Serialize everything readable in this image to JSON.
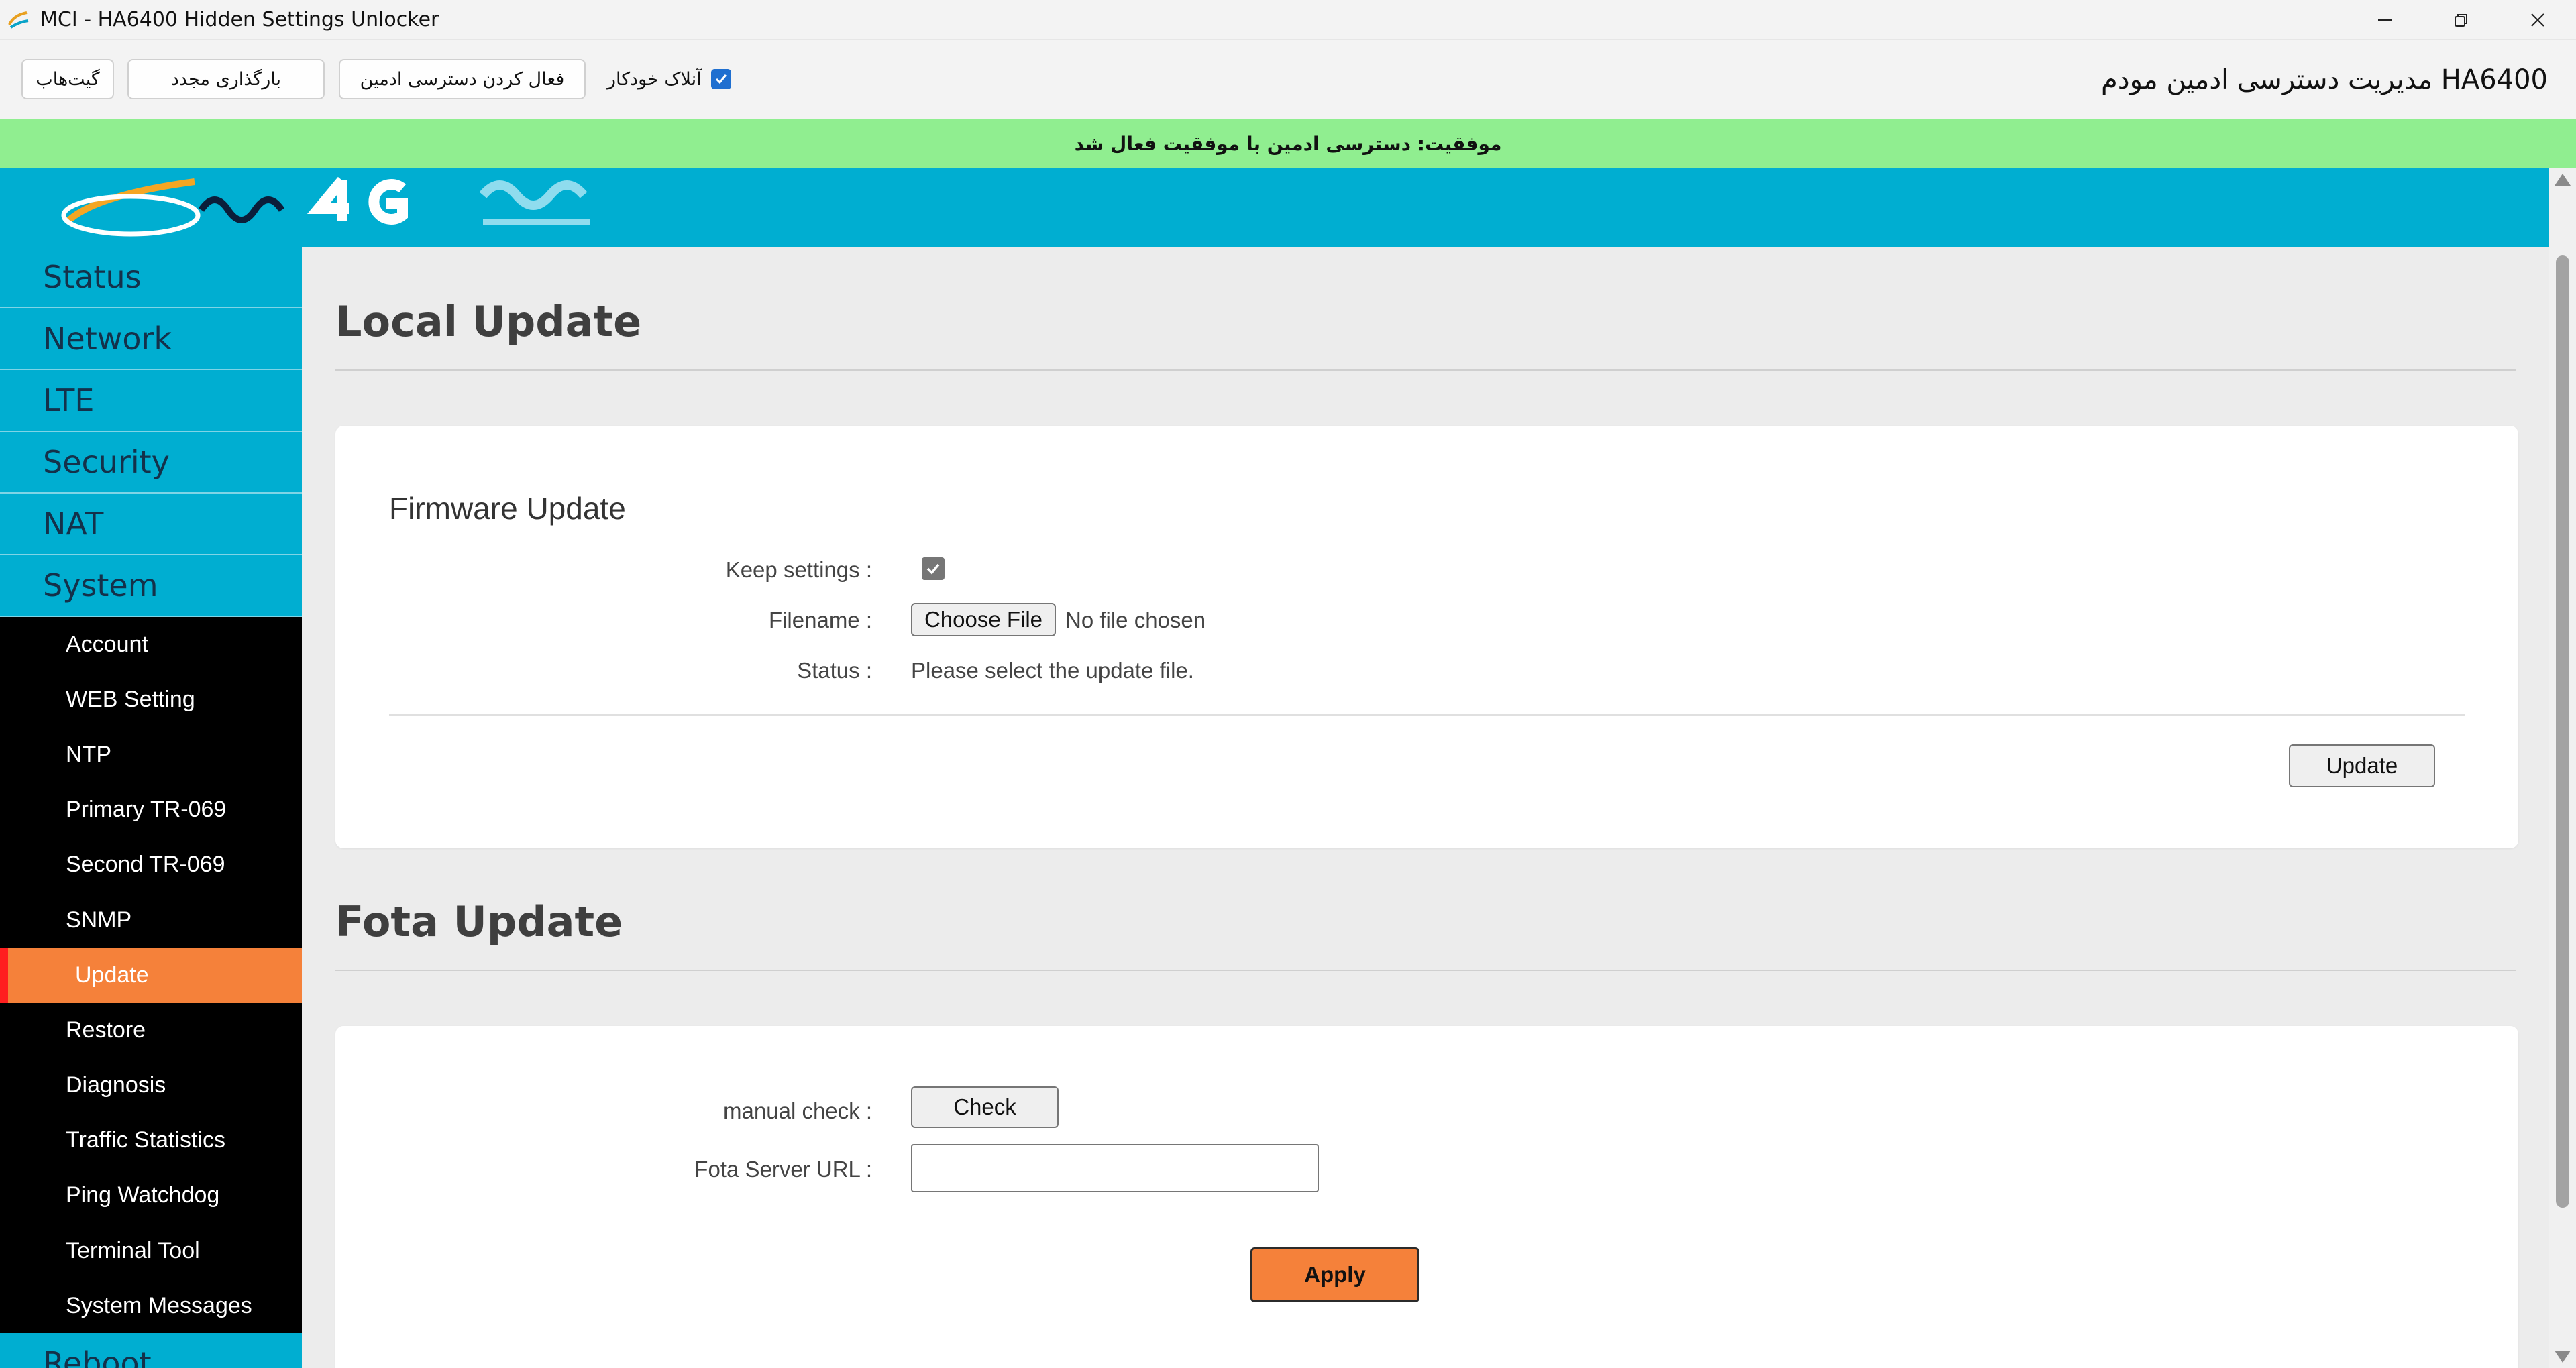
{
  "window": {
    "title": "MCI - HA6400 Hidden Settings Unlocker"
  },
  "toolbar": {
    "heading": "مدیریت دسترسی ادمین مودم HA6400",
    "auto_unlock_label": "آنلاک خودکار",
    "enable_admin_label": "فعال کردن دسترسی ادمین",
    "reload_label": "بارگذاری مجدد",
    "github_label": "گیت‌هاب"
  },
  "banner": {
    "message": "موفقیت: دسترسی ادمین با موفقیت فعال شد",
    "color": "#90ee90"
  },
  "header": {
    "brand_color": "#00aed1"
  },
  "sidebar": {
    "main_items": [
      {
        "label": "Status"
      },
      {
        "label": "Network"
      },
      {
        "label": "LTE"
      },
      {
        "label": "Security"
      },
      {
        "label": "NAT"
      },
      {
        "label": "System"
      }
    ],
    "sub_items": [
      {
        "label": "Account"
      },
      {
        "label": "WEB Setting"
      },
      {
        "label": "NTP"
      },
      {
        "label": "Primary TR-069"
      },
      {
        "label": "Second TR-069"
      },
      {
        "label": "SNMP"
      },
      {
        "label": "Update"
      },
      {
        "label": "Restore"
      },
      {
        "label": "Diagnosis"
      },
      {
        "label": "Traffic Statistics"
      },
      {
        "label": "Ping Watchdog"
      },
      {
        "label": "Terminal Tool"
      },
      {
        "label": "System Messages"
      }
    ],
    "bottom_item": {
      "label": "Reboot"
    },
    "active_item": "Update",
    "active_color": "#f5813a"
  },
  "local_update": {
    "title": "Local Update",
    "card_title": "Firmware Update",
    "keep_settings_label": "Keep settings :",
    "filename_label": "Filename :",
    "choose_file_label": "Choose File",
    "no_file_text": "No file chosen",
    "status_label": "Status :",
    "status_value": "Please select the update file.",
    "update_button": "Update"
  },
  "fota_update": {
    "title": "Fota Update",
    "manual_check_label": "manual check :",
    "check_button": "Check",
    "server_url_label": "Fota Server URL :",
    "server_url_value": "",
    "apply_button": "Apply",
    "apply_color": "#f5813a"
  }
}
